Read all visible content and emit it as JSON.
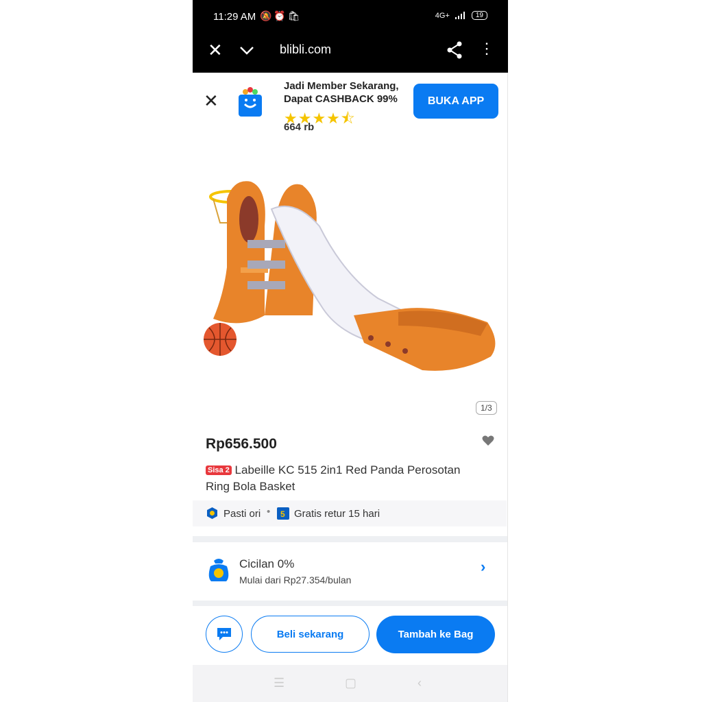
{
  "status_bar": {
    "time": "11:29 AM",
    "network": "4G+",
    "battery": "19"
  },
  "browser": {
    "url": "blibli.com"
  },
  "banner": {
    "line1": "Jadi Member Sekarang,",
    "line2": "Dapat CASHBACK 99%",
    "stars": "★★★★⯪",
    "reviews": "664 rb",
    "open_app_label": "BUKA APP"
  },
  "product": {
    "image_counter": "1/3",
    "price": "Rp656.500",
    "stock_badge": "Sisa 2",
    "title": "Labeille KC 515 2in1 Red Panda Perosotan Ring Bola Basket",
    "assurance_original": "Pasti ori",
    "assurance_return": "Gratis retur 15 hari"
  },
  "installment": {
    "title": "Cicilan 0%",
    "subtitle": "Mulai dari Rp27.354/bulan"
  },
  "actions": {
    "buy_now": "Beli sekarang",
    "add_to_bag": "Tambah ke Bag"
  },
  "colors": {
    "accent": "#0a7bf2",
    "badge": "#e8383d",
    "star": "#f5c400",
    "slide_orange": "#e8842a"
  }
}
